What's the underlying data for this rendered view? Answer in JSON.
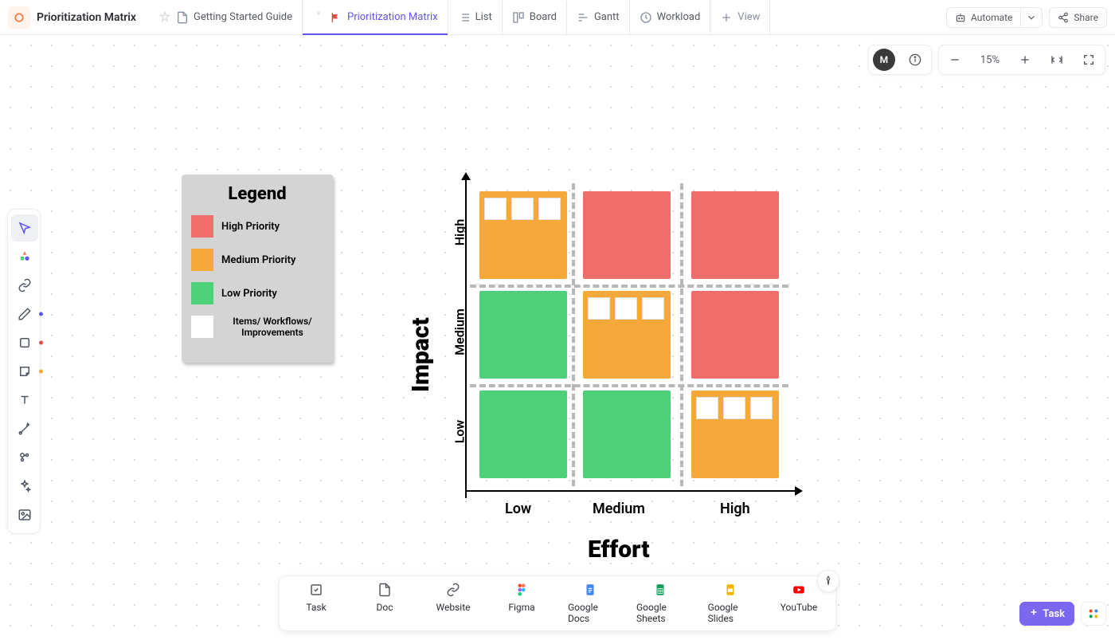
{
  "header": {
    "title": "Prioritization Matrix",
    "tabs": [
      {
        "label": "Getting Started Guide"
      },
      {
        "label": "Prioritization Matrix"
      },
      {
        "label": "List"
      },
      {
        "label": "Board"
      },
      {
        "label": "Gantt"
      },
      {
        "label": "Workload"
      },
      {
        "label": "View"
      }
    ],
    "automate": "Automate",
    "share": "Share"
  },
  "zoom": {
    "avatar": "M",
    "percent": "15%"
  },
  "legend": {
    "title": "Legend",
    "items": [
      {
        "label": "High Priority"
      },
      {
        "label": "Medium Priority"
      },
      {
        "label": "Low Priority"
      },
      {
        "label": "Items/ Workflows/ Improvements"
      }
    ]
  },
  "matrix": {
    "ylabel": "Impact",
    "xlabel": "Effort",
    "yticks": [
      "High",
      "Medium",
      "Low"
    ],
    "xticks": [
      "Low",
      "Medium",
      "High"
    ]
  },
  "bottom": {
    "items": [
      {
        "label": "Task"
      },
      {
        "label": "Doc"
      },
      {
        "label": "Website"
      },
      {
        "label": "Figma"
      },
      {
        "label": "Google Docs"
      },
      {
        "label": "Google Sheets"
      },
      {
        "label": "Google Slides"
      },
      {
        "label": "YouTube"
      }
    ]
  },
  "bottomRight": {
    "task": "Task"
  },
  "chart_data": {
    "type": "heatmap",
    "title": "Prioritization Matrix",
    "xlabel": "Effort",
    "ylabel": "Impact",
    "x_categories": [
      "Low",
      "Medium",
      "High"
    ],
    "y_categories": [
      "Low",
      "Medium",
      "High"
    ],
    "priority_grid_rows_top_to_bottom": [
      [
        "Medium Priority",
        "High Priority",
        "High Priority"
      ],
      [
        "Low Priority",
        "Medium Priority",
        "High Priority"
      ],
      [
        "Low Priority",
        "Low Priority",
        "Medium Priority"
      ]
    ],
    "legend": {
      "High Priority": "#ef6d6a",
      "Medium Priority": "#f6a93b",
      "Low Priority": "#4dd077",
      "Items/ Workflows/ Improvements": "#ffffff"
    },
    "item_cards_per_cell": {
      "High_Low": 3,
      "Medium_Medium": 3,
      "Low_High": 3
    }
  }
}
